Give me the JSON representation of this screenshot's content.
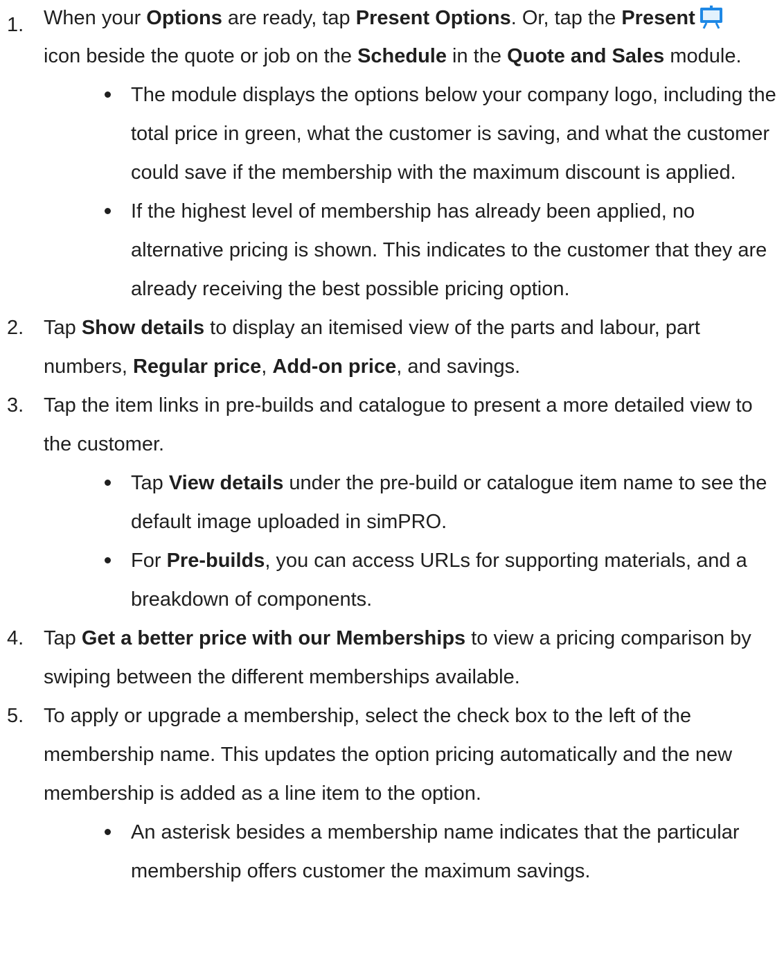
{
  "steps": [
    {
      "number": "1.",
      "segments": [
        "When your ",
        "Options",
        " are ready, tap ",
        "Present Options",
        ". Or, tap the ",
        "Present",
        "icon beside the quote or job on the ",
        "Schedule",
        " in the ",
        "Quote and Sales",
        " module."
      ],
      "present_icon": "present-easel-icon",
      "bullets": [
        "The module displays the options below your company logo, including the total price in green, what the customer is saving, and what the customer could save if the membership with the maximum discount is applied.",
        "If the highest level of membership has already been applied, no alternative pricing is shown. This indicates to the customer that they are already receiving the best possible pricing option."
      ]
    },
    {
      "number": "2.",
      "segments": [
        "Tap ",
        "Show details",
        " to display an itemised view of the parts and labour, part numbers, ",
        "Regular price",
        ", ",
        "Add-on price",
        ", and savings."
      ]
    },
    {
      "number": "3.",
      "text": "Tap the item links in pre-builds and catalogue to present a more detailed view to the customer.",
      "bullets": [
        {
          "segments": [
            "Tap ",
            "View details",
            " under the pre-build or catalogue item name to see the default image uploaded in simPRO."
          ]
        },
        {
          "segments": [
            "For ",
            "Pre-builds",
            ", you can access URLs for supporting materials, and a breakdown of components."
          ]
        }
      ]
    },
    {
      "number": "4.",
      "segments": [
        "Tap ",
        "Get a better price with our Memberships",
        " to view a pricing comparison by swiping between the different memberships available."
      ]
    },
    {
      "number": "5.",
      "text": "To apply or upgrade a membership, select the check box to the left of the membership name. This updates the option pricing automatically and the new membership is added as a line item to the option.",
      "bullets": [
        "An asterisk besides a membership name indicates that the particular membership offers customer the maximum savings."
      ]
    }
  ],
  "colors": {
    "text": "#1f1f1f",
    "icon_blue": "#1e88e5",
    "icon_light": "#e3f2fd"
  }
}
